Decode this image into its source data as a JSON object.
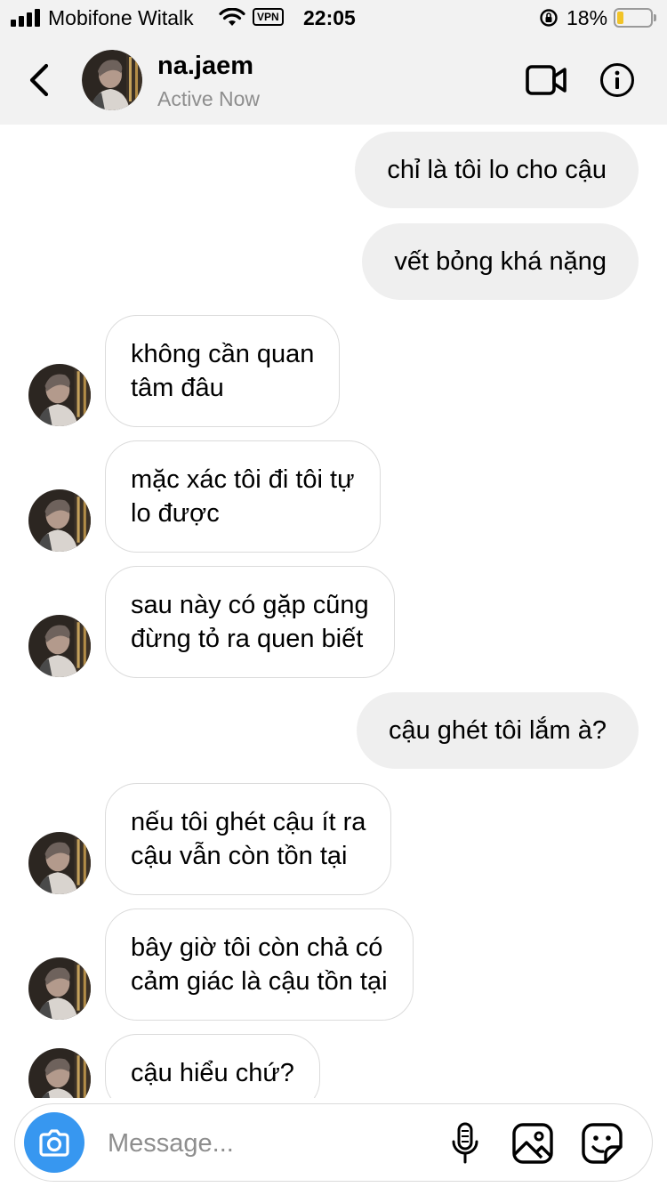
{
  "status_bar": {
    "carrier": "Mobifone Witalk",
    "vpn": "VPN",
    "time": "22:05",
    "battery_percent": "18%",
    "battery_level": 0.18,
    "battery_color": "#f2c428"
  },
  "header": {
    "username": "na.jaem",
    "status": "Active Now",
    "icons": [
      "back-chevron",
      "avatar",
      "video-camera",
      "info"
    ]
  },
  "messages": [
    {
      "side": "out",
      "text": "chỉ là tôi lo cho cậu"
    },
    {
      "side": "out",
      "text": "vết bỏng khá nặng"
    },
    {
      "side": "in",
      "text": "không cần quan\ntâm đâu"
    },
    {
      "side": "in",
      "text": "mặc xác tôi đi tôi tự\nlo được"
    },
    {
      "side": "in",
      "text": "sau này có gặp cũng\nđừng tỏ ra quen biết"
    },
    {
      "side": "out",
      "text": "cậu ghét tôi lắm à?"
    },
    {
      "side": "in",
      "text": "nếu tôi ghét cậu ít ra\ncậu vẫn còn tồn tại"
    },
    {
      "side": "in",
      "text": "bây giờ tôi còn chả có\ncảm giác là cậu tồn tại"
    },
    {
      "side": "in",
      "text": "cậu hiểu chứ?"
    }
  ],
  "composer": {
    "placeholder": "Message...",
    "value": "",
    "icons": [
      "camera",
      "microphone",
      "gallery",
      "sticker"
    ]
  },
  "colors": {
    "accent": "#3797f0",
    "outgoing_bubble": "#efefef",
    "incoming_border": "#dbdbdb",
    "header_bg": "#f2f2f2",
    "muted_text": "#8e8e8e"
  }
}
